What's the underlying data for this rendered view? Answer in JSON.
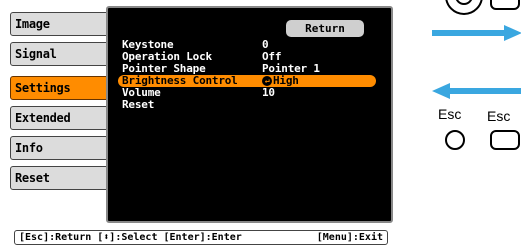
{
  "tabs": [
    {
      "label": "Image",
      "active": false
    },
    {
      "label": "Signal",
      "active": false
    },
    {
      "label": "Settings",
      "active": true
    },
    {
      "label": "Extended",
      "active": false
    },
    {
      "label": "Info",
      "active": false
    },
    {
      "label": "Reset",
      "active": false
    }
  ],
  "panel": {
    "return_label": "Return",
    "items": [
      {
        "label": "Keystone",
        "value": "0"
      },
      {
        "label": "Operation Lock",
        "value": "Off"
      },
      {
        "label": "Pointer Shape",
        "value": "Pointer 1"
      },
      {
        "label": "Brightness Control",
        "value": "High",
        "selected": true
      },
      {
        "label": "Volume",
        "value": "10"
      },
      {
        "label": "Reset",
        "value": ""
      }
    ]
  },
  "status_bar": {
    "left": "[Esc]:Return [⬍]:Select [Enter]:Enter",
    "right": "[Menu]:Exit"
  },
  "remote": {
    "esc_labels": [
      "Esc",
      "Esc"
    ]
  },
  "colors": {
    "accent": "#ff8c00",
    "panel_bg": "#000000",
    "tab_bg": "#dcdcdc",
    "arrow": "#3aa7e0"
  }
}
